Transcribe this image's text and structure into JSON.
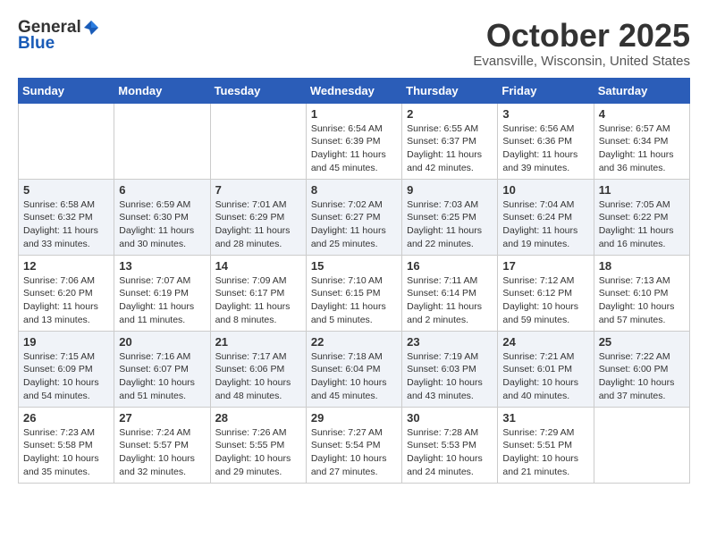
{
  "header": {
    "logo_general": "General",
    "logo_blue": "Blue",
    "month_title": "October 2025",
    "location": "Evansville, Wisconsin, United States"
  },
  "days_of_week": [
    "Sunday",
    "Monday",
    "Tuesday",
    "Wednesday",
    "Thursday",
    "Friday",
    "Saturday"
  ],
  "weeks": [
    {
      "cells": [
        {
          "day": null,
          "content": null
        },
        {
          "day": null,
          "content": null
        },
        {
          "day": null,
          "content": null
        },
        {
          "day": "1",
          "content": "Sunrise: 6:54 AM\nSunset: 6:39 PM\nDaylight: 11 hours\nand 45 minutes."
        },
        {
          "day": "2",
          "content": "Sunrise: 6:55 AM\nSunset: 6:37 PM\nDaylight: 11 hours\nand 42 minutes."
        },
        {
          "day": "3",
          "content": "Sunrise: 6:56 AM\nSunset: 6:36 PM\nDaylight: 11 hours\nand 39 minutes."
        },
        {
          "day": "4",
          "content": "Sunrise: 6:57 AM\nSunset: 6:34 PM\nDaylight: 11 hours\nand 36 minutes."
        }
      ]
    },
    {
      "cells": [
        {
          "day": "5",
          "content": "Sunrise: 6:58 AM\nSunset: 6:32 PM\nDaylight: 11 hours\nand 33 minutes."
        },
        {
          "day": "6",
          "content": "Sunrise: 6:59 AM\nSunset: 6:30 PM\nDaylight: 11 hours\nand 30 minutes."
        },
        {
          "day": "7",
          "content": "Sunrise: 7:01 AM\nSunset: 6:29 PM\nDaylight: 11 hours\nand 28 minutes."
        },
        {
          "day": "8",
          "content": "Sunrise: 7:02 AM\nSunset: 6:27 PM\nDaylight: 11 hours\nand 25 minutes."
        },
        {
          "day": "9",
          "content": "Sunrise: 7:03 AM\nSunset: 6:25 PM\nDaylight: 11 hours\nand 22 minutes."
        },
        {
          "day": "10",
          "content": "Sunrise: 7:04 AM\nSunset: 6:24 PM\nDaylight: 11 hours\nand 19 minutes."
        },
        {
          "day": "11",
          "content": "Sunrise: 7:05 AM\nSunset: 6:22 PM\nDaylight: 11 hours\nand 16 minutes."
        }
      ]
    },
    {
      "cells": [
        {
          "day": "12",
          "content": "Sunrise: 7:06 AM\nSunset: 6:20 PM\nDaylight: 11 hours\nand 13 minutes."
        },
        {
          "day": "13",
          "content": "Sunrise: 7:07 AM\nSunset: 6:19 PM\nDaylight: 11 hours\nand 11 minutes."
        },
        {
          "day": "14",
          "content": "Sunrise: 7:09 AM\nSunset: 6:17 PM\nDaylight: 11 hours\nand 8 minutes."
        },
        {
          "day": "15",
          "content": "Sunrise: 7:10 AM\nSunset: 6:15 PM\nDaylight: 11 hours\nand 5 minutes."
        },
        {
          "day": "16",
          "content": "Sunrise: 7:11 AM\nSunset: 6:14 PM\nDaylight: 11 hours\nand 2 minutes."
        },
        {
          "day": "17",
          "content": "Sunrise: 7:12 AM\nSunset: 6:12 PM\nDaylight: 10 hours\nand 59 minutes."
        },
        {
          "day": "18",
          "content": "Sunrise: 7:13 AM\nSunset: 6:10 PM\nDaylight: 10 hours\nand 57 minutes."
        }
      ]
    },
    {
      "cells": [
        {
          "day": "19",
          "content": "Sunrise: 7:15 AM\nSunset: 6:09 PM\nDaylight: 10 hours\nand 54 minutes."
        },
        {
          "day": "20",
          "content": "Sunrise: 7:16 AM\nSunset: 6:07 PM\nDaylight: 10 hours\nand 51 minutes."
        },
        {
          "day": "21",
          "content": "Sunrise: 7:17 AM\nSunset: 6:06 PM\nDaylight: 10 hours\nand 48 minutes."
        },
        {
          "day": "22",
          "content": "Sunrise: 7:18 AM\nSunset: 6:04 PM\nDaylight: 10 hours\nand 45 minutes."
        },
        {
          "day": "23",
          "content": "Sunrise: 7:19 AM\nSunset: 6:03 PM\nDaylight: 10 hours\nand 43 minutes."
        },
        {
          "day": "24",
          "content": "Sunrise: 7:21 AM\nSunset: 6:01 PM\nDaylight: 10 hours\nand 40 minutes."
        },
        {
          "day": "25",
          "content": "Sunrise: 7:22 AM\nSunset: 6:00 PM\nDaylight: 10 hours\nand 37 minutes."
        }
      ]
    },
    {
      "cells": [
        {
          "day": "26",
          "content": "Sunrise: 7:23 AM\nSunset: 5:58 PM\nDaylight: 10 hours\nand 35 minutes."
        },
        {
          "day": "27",
          "content": "Sunrise: 7:24 AM\nSunset: 5:57 PM\nDaylight: 10 hours\nand 32 minutes."
        },
        {
          "day": "28",
          "content": "Sunrise: 7:26 AM\nSunset: 5:55 PM\nDaylight: 10 hours\nand 29 minutes."
        },
        {
          "day": "29",
          "content": "Sunrise: 7:27 AM\nSunset: 5:54 PM\nDaylight: 10 hours\nand 27 minutes."
        },
        {
          "day": "30",
          "content": "Sunrise: 7:28 AM\nSunset: 5:53 PM\nDaylight: 10 hours\nand 24 minutes."
        },
        {
          "day": "31",
          "content": "Sunrise: 7:29 AM\nSunset: 5:51 PM\nDaylight: 10 hours\nand 21 minutes."
        },
        {
          "day": null,
          "content": null
        }
      ]
    }
  ]
}
